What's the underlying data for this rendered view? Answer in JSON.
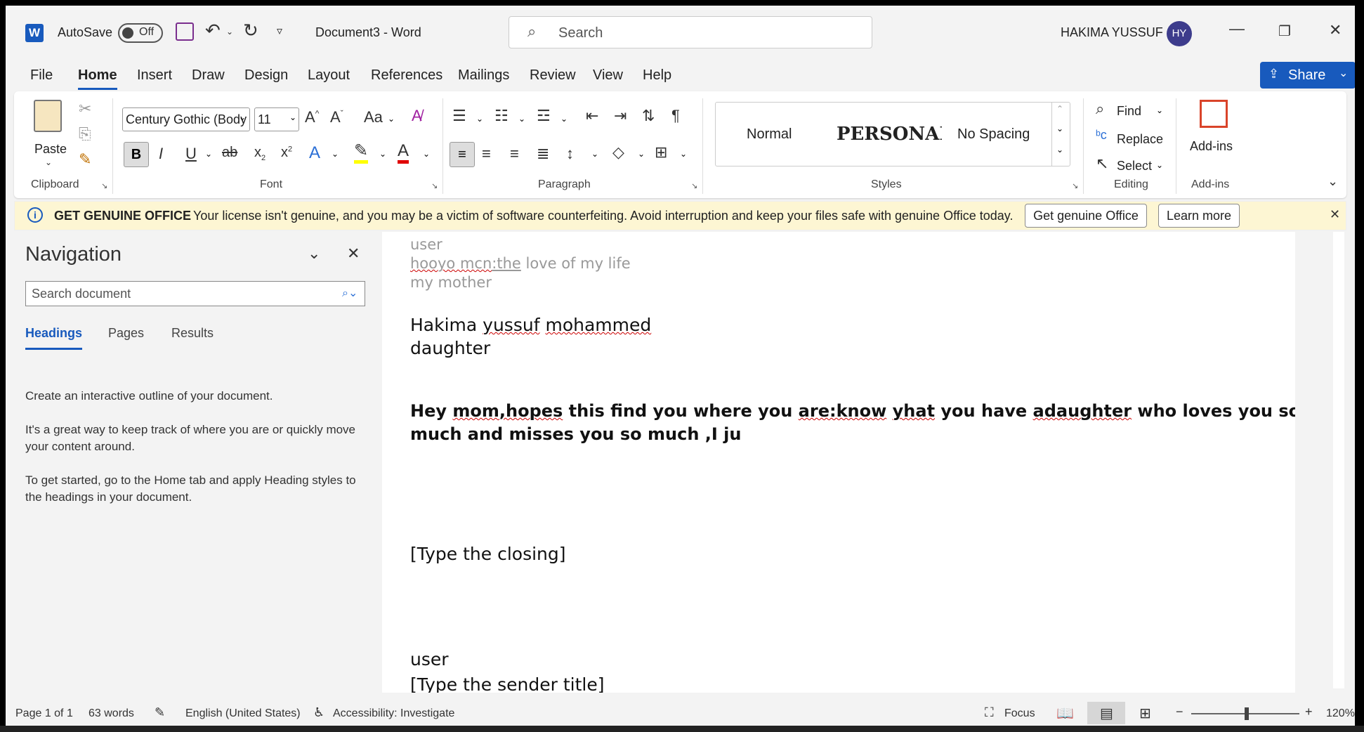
{
  "titlebar": {
    "autosave_label": "AutoSave",
    "autosave_state": "Off",
    "document_title": "Document3  -  Word",
    "search_placeholder": "Search",
    "user_name": "HAKIMA YUSSUF",
    "user_initials": "HY",
    "minimize": "—",
    "restore": "❐",
    "close": "✕"
  },
  "menu_tabs": [
    "File",
    "Home",
    "Insert",
    "Draw",
    "Design",
    "Layout",
    "References",
    "Mailings",
    "Review",
    "View",
    "Help"
  ],
  "share_label": "Share",
  "ribbon": {
    "clipboard": {
      "group_label": "Clipboard",
      "paste_label": "Paste"
    },
    "font": {
      "group_label": "Font",
      "font_name": "Century Gothic (Body",
      "font_size": "11"
    },
    "paragraph": {
      "group_label": "Paragraph"
    },
    "styles": {
      "group_label": "Styles",
      "items": [
        "Normal",
        "PERSONAI",
        "No Spacing"
      ]
    },
    "editing": {
      "group_label": "Editing",
      "find": "Find",
      "replace": "Replace",
      "select": "Select"
    },
    "addins": {
      "group_label": "Add-ins",
      "label": "Add-ins"
    }
  },
  "banner": {
    "title": "GET GENUINE OFFICE",
    "message": "Your license isn't genuine, and you may be a victim of software counterfeiting. Avoid interruption and keep your files safe with genuine Office today.",
    "button_primary": "Get genuine Office",
    "button_secondary": "Learn more"
  },
  "navigation": {
    "title": "Navigation",
    "search_placeholder": "Search document",
    "tabs": [
      "Headings",
      "Pages",
      "Results"
    ],
    "paragraphs": [
      "Create an interactive outline of your document.",
      "It's a great way to keep track of where you are or quickly move your content around.",
      "To get started, go to the Home tab and apply Heading styles to the headings in your document."
    ]
  },
  "document": {
    "line1": "user",
    "line2_a": "hooyo mcn",
    "line2_b": ":the",
    "line2_c": " love of my life",
    "line3": "my mother",
    "name_a": "Hakima ",
    "name_b": "yussuf",
    "name_c": " ",
    "name_d": "mohammed",
    "relation": "daughter",
    "body_1a": "Hey ",
    "body_1b": "mom,hopes",
    "body_1c": " this find you where you ",
    "body_1d": "are:know",
    "body_1e": " ",
    "body_1f": "yhat",
    "body_1g": " you have ",
    "body_1h": "adaughter",
    "body_1i": " who loves you so",
    "body_2": "much and misses you so much ,I ju",
    "closing": "[Type the closing]",
    "sender": "user",
    "sender_title": "[Type the sender title]"
  },
  "status": {
    "page": "Page 1 of 1",
    "words": "63 words",
    "language": "English (United States)",
    "accessibility": "Accessibility: Investigate",
    "focus": "Focus",
    "zoom": "120%"
  }
}
